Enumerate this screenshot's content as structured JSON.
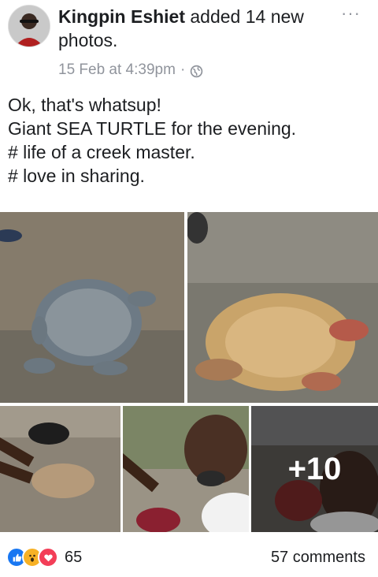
{
  "post": {
    "author": "Kingpin Eshiet",
    "action": "added 14 new photos.",
    "timestamp": "15 Feb at 4:39pm",
    "separator": "·",
    "privacy_icon": "globe-icon",
    "more_label": "···",
    "text_lines": [
      "Ok, that's whatsup!",
      "Giant SEA TURTLE for the evening.",
      "# life of a creek master.",
      "# love in sharing."
    ]
  },
  "photos": {
    "more_count": "+10"
  },
  "footer": {
    "reactions": [
      "like-icon",
      "wow-icon",
      "love-icon"
    ],
    "reaction_count": "65",
    "comments": "57 comments"
  },
  "colors": {
    "text": "#1c1e21",
    "meta": "#90949c",
    "like": "#1877f2",
    "wow": "#f7b125",
    "love": "#f33e58"
  }
}
